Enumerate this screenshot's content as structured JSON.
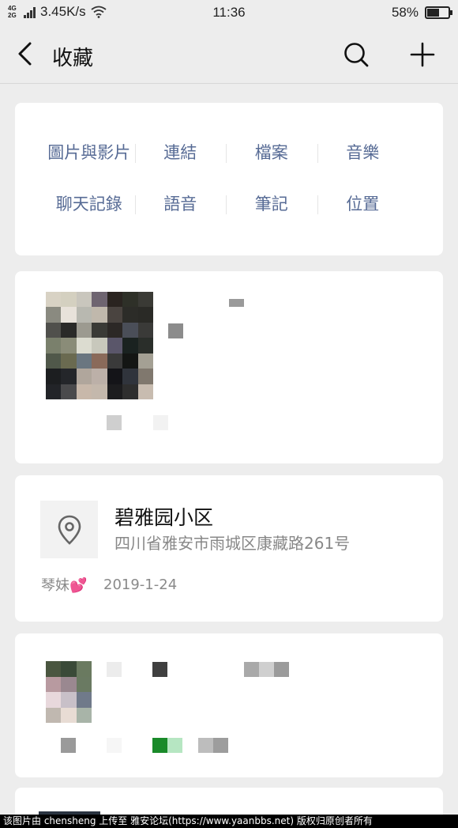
{
  "status_bar": {
    "network_type": "4G",
    "network_type_2": "2G",
    "speed": "3.45K/s",
    "time": "11:36",
    "battery": "58%",
    "battery_level": 0.58
  },
  "nav": {
    "title": "收藏"
  },
  "categories": {
    "row1": [
      "圖片與影片",
      "連結",
      "檔案",
      "音樂"
    ],
    "row2": [
      "聊天記錄",
      "語音",
      "筆記",
      "位置"
    ]
  },
  "location_item": {
    "title": "碧雅园小区",
    "address": "四川省雅安市雨城区康藏路261号",
    "source": "琴妹💕",
    "date": "2019-1-24"
  },
  "watermark": "该图片由 chensheng 上传至 雅安论坛(https://www.yaanbbs.net) 版权归原创者所有",
  "colors": {
    "accent_link": "#576b95",
    "background": "#ededed",
    "card": "#ffffff"
  }
}
